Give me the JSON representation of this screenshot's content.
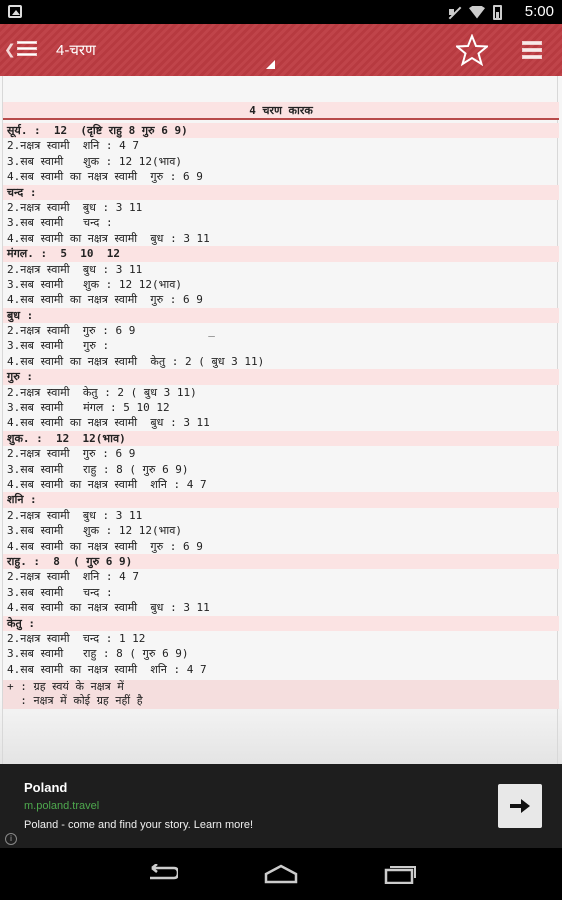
{
  "status_bar": {
    "time": "5:00"
  },
  "action_bar": {
    "title": "4-चरण"
  },
  "table": {
    "header": "4 चरण कारक",
    "lines": [
      {
        "text": "सूर्य. :  12  (दृष्टि राहु 8 गुरु 6 9)",
        "hd": true
      },
      {
        "text": "2.नक्षत्र स्वामी  शनि : 4 7",
        "hd": false
      },
      {
        "text": "3.सब स्वामी   शुक : 12 12(भाव)",
        "hd": false
      },
      {
        "text": "4.सब स्वामी का नक्षत्र स्वामी  गुरु : 6 9",
        "hd": false
      },
      {
        "text": "चन्द :",
        "hd": true
      },
      {
        "text": "2.नक्षत्र स्वामी  बुध : 3 11",
        "hd": false
      },
      {
        "text": "3.सब स्वामी   चन्द :",
        "hd": false
      },
      {
        "text": "4.सब स्वामी का नक्षत्र स्वामी  बुध : 3 11",
        "hd": false
      },
      {
        "text": "मंगल. :  5  10  12",
        "hd": true
      },
      {
        "text": "2.नक्षत्र स्वामी  बुध : 3 11",
        "hd": false
      },
      {
        "text": "3.सब स्वामी   शुक : 12 12(भाव)",
        "hd": false
      },
      {
        "text": "4.सब स्वामी का नक्षत्र स्वामी  गुरु : 6 9",
        "hd": false
      },
      {
        "text": "बुध :",
        "hd": true
      },
      {
        "text": "2.नक्षत्र स्वामी  गुरु : 6 9           _",
        "hd": false
      },
      {
        "text": "3.सब स्वामी   गुरु :",
        "hd": false
      },
      {
        "text": "4.सब स्वामी का नक्षत्र स्वामी  केतु : 2 ( बुध 3 11)",
        "hd": false
      },
      {
        "text": "गुरु :",
        "hd": true
      },
      {
        "text": "2.नक्षत्र स्वामी  केतु : 2 ( बुध 3 11)",
        "hd": false
      },
      {
        "text": "3.सब स्वामी   मंगल : 5 10 12",
        "hd": false
      },
      {
        "text": "4.सब स्वामी का नक्षत्र स्वामी  बुध : 3 11",
        "hd": false
      },
      {
        "text": "शुक. :  12  12(भाव)",
        "hd": true
      },
      {
        "text": "2.नक्षत्र स्वामी  गुरु : 6 9",
        "hd": false
      },
      {
        "text": "3.सब स्वामी   राहु : 8 ( गुरु 6 9)",
        "hd": false
      },
      {
        "text": "4.सब स्वामी का नक्षत्र स्वामी  शनि : 4 7",
        "hd": false
      },
      {
        "text": "शनि :",
        "hd": true
      },
      {
        "text": "2.नक्षत्र स्वामी  बुध : 3 11",
        "hd": false
      },
      {
        "text": "3.सब स्वामी   शुक : 12 12(भाव)",
        "hd": false
      },
      {
        "text": "4.सब स्वामी का नक्षत्र स्वामी  गुरु : 6 9",
        "hd": false
      },
      {
        "text": "राहु. :  8  ( गुरु 6 9)",
        "hd": true
      },
      {
        "text": "2.नक्षत्र स्वामी  शनि : 4 7",
        "hd": false
      },
      {
        "text": "3.सब स्वामी   चन्द :",
        "hd": false
      },
      {
        "text": "4.सब स्वामी का नक्षत्र स्वामी  बुध : 3 11",
        "hd": false
      },
      {
        "text": "केतु :",
        "hd": true
      },
      {
        "text": "2.नक्षत्र स्वामी  चन्द : 1 12",
        "hd": false
      },
      {
        "text": "3.सब स्वामी   राहु : 8 ( गुरु 6 9)",
        "hd": false
      },
      {
        "text": "4.सब स्वामी का नक्षत्र स्वामी  शनि : 4 7",
        "hd": false
      }
    ],
    "notes": [
      "+ : ग्रह स्वयं के नक्षत्र में",
      "  : नक्षत्र में कोई ग्रह नहीं है"
    ]
  },
  "ad": {
    "title": "Poland",
    "url": "m.poland.travel",
    "description": "Poland - come and find your story. Learn more!",
    "info_glyph": "i"
  },
  "icons": {
    "status": [
      "picture-icon",
      "mute-icon",
      "wifi-icon",
      "battery-icon"
    ],
    "action_bar": [
      "menu-icon",
      "star-icon",
      "overflow-menu-icon"
    ],
    "nav": [
      "back-icon",
      "home-icon",
      "recents-icon"
    ]
  },
  "colors": {
    "accent": "#b73a40",
    "row_highlight": "#fbe3e3",
    "ad_url": "#4ea94e"
  }
}
